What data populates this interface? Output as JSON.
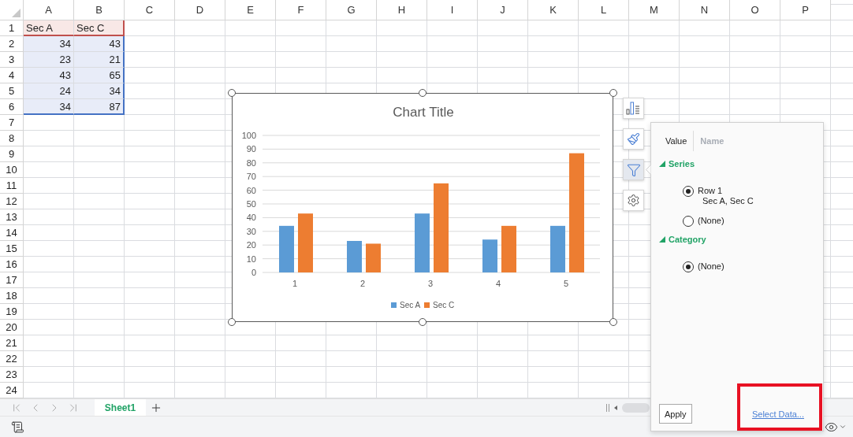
{
  "sheet": {
    "columns": [
      "A",
      "B",
      "C",
      "D",
      "E",
      "F",
      "G",
      "H",
      "I",
      "J",
      "K",
      "L",
      "M",
      "N",
      "O",
      "P"
    ],
    "rows": [
      "1",
      "2",
      "3",
      "4",
      "5",
      "6",
      "7",
      "8",
      "9",
      "10",
      "11",
      "12",
      "13",
      "14",
      "15",
      "16",
      "17",
      "18",
      "19",
      "20",
      "21",
      "22",
      "23",
      "24"
    ],
    "header_cells": [
      "Sec A",
      "Sec C"
    ],
    "value_cells": [
      [
        "34",
        "43"
      ],
      [
        "23",
        "21"
      ],
      [
        "43",
        "65"
      ],
      [
        "24",
        "34"
      ],
      [
        "34",
        "87"
      ]
    ]
  },
  "chart": {
    "chart_data": {
      "type": "bar",
      "title": "Chart Title",
      "categories": [
        "1",
        "2",
        "3",
        "4",
        "5"
      ],
      "series": [
        {
          "name": "Sec A",
          "color": "#5b9bd5",
          "values": [
            34,
            23,
            43,
            24,
            34
          ]
        },
        {
          "name": "Sec C",
          "color": "#ed7d31",
          "values": [
            43,
            21,
            65,
            34,
            87
          ]
        }
      ],
      "ylim": [
        0,
        100
      ],
      "yticks": [
        0,
        10,
        20,
        30,
        40,
        50,
        60,
        70,
        80,
        90,
        100
      ],
      "grid": true,
      "legend": true
    }
  },
  "chart_tools": [
    {
      "kind": "elements",
      "selected": false
    },
    {
      "kind": "styles",
      "selected": false
    },
    {
      "kind": "filter",
      "selected": true
    },
    {
      "kind": "settings",
      "selected": false
    }
  ],
  "filter_panel": {
    "tabs": [
      {
        "label": "Value",
        "selected": true
      },
      {
        "label": "Name",
        "selected": false
      }
    ],
    "sections": [
      {
        "title": "Series",
        "expanded": true,
        "options": [
          {
            "label": "Row 1",
            "detail": "Sec A, Sec C",
            "selected": true
          },
          {
            "label": "(None)",
            "selected": false
          }
        ]
      },
      {
        "title": "Category",
        "expanded": true,
        "options": [
          {
            "label": "(None)",
            "selected": true
          }
        ]
      }
    ],
    "apply": "Apply",
    "link": "Select Data..."
  },
  "sheet_tabs": [
    {
      "label": "Sheet1",
      "selected": true
    }
  ]
}
